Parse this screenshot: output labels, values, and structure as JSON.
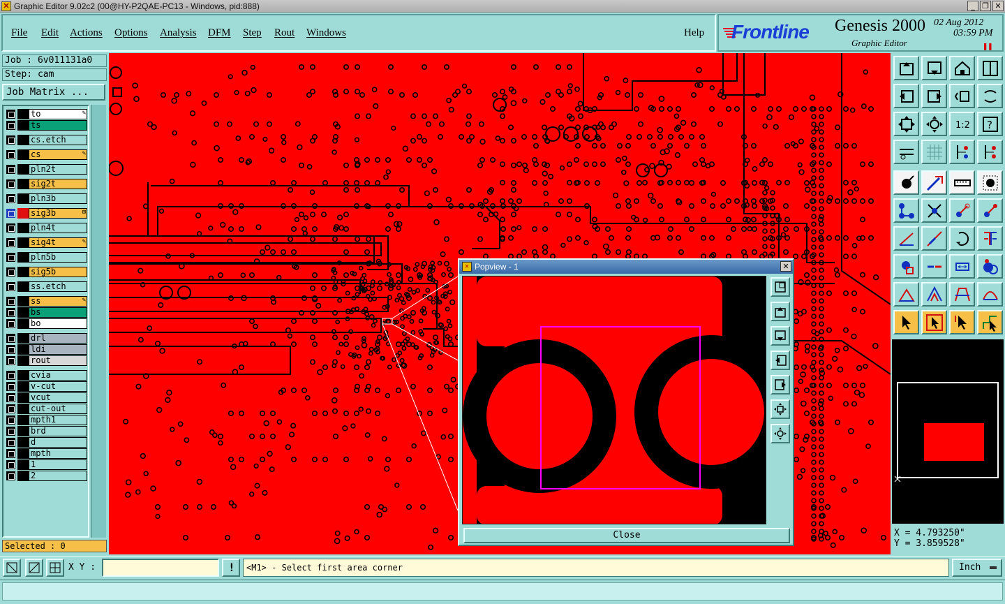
{
  "window": {
    "title": "Graphic Editor 9.02c2 (00@HY-P2QAE-PC13 - Windows, pid:888)",
    "controls": [
      "_",
      "❐",
      "✕"
    ]
  },
  "menu": {
    "items": [
      "File",
      "Edit",
      "Actions",
      "Options",
      "Analysis",
      "DFM",
      "Step",
      "Rout",
      "Windows"
    ],
    "help": "Help"
  },
  "brand": {
    "logo": "Frontline",
    "product": "Genesis 2000",
    "subtitle": "Graphic Editor",
    "date": "02 Aug 2012",
    "time": "03:59 PM"
  },
  "job": {
    "job_text": "Job : 6v011131a0",
    "step_text": "Step: cam",
    "job_matrix_label": "Job Matrix ...",
    "selected_text": "Selected : 0"
  },
  "layers": [
    {
      "name": "to",
      "color": "#ffffff",
      "mark": "✎"
    },
    {
      "name": "ts",
      "color": "#0aa078",
      "mark": ""
    },
    {
      "name": "cs.etch",
      "color": "#9fdcd8",
      "mark": ""
    },
    {
      "name": "cs",
      "color": "#f6c048",
      "mark": "✎"
    },
    {
      "name": "pln2t",
      "color": "#9fdcd8",
      "mark": ""
    },
    {
      "name": "sig2t",
      "color": "#f6c048",
      "mark": ""
    },
    {
      "name": "pln3b",
      "color": "#9fdcd8",
      "mark": ""
    },
    {
      "name": "sig3b",
      "color": "#f6c048",
      "mark": "⊞"
    },
    {
      "name": "pln4t",
      "color": "#9fdcd8",
      "mark": ""
    },
    {
      "name": "sig4t",
      "color": "#f6c048",
      "mark": "✎"
    },
    {
      "name": "pln5b",
      "color": "#9fdcd8",
      "mark": ""
    },
    {
      "name": "sig5b",
      "color": "#f6c048",
      "mark": ""
    },
    {
      "name": "ss.etch",
      "color": "#9fdcd8",
      "mark": ""
    },
    {
      "name": "ss",
      "color": "#f6c048",
      "mark": "✎"
    },
    {
      "name": "bs",
      "color": "#0aa078",
      "mark": ""
    },
    {
      "name": "bo",
      "color": "#ffffff",
      "mark": ""
    },
    {
      "name": "drl",
      "color": "#a8b4c0",
      "mark": ""
    },
    {
      "name": "ldi",
      "color": "#a8b4c0",
      "mark": ""
    },
    {
      "name": "rout",
      "color": "#d8d8d8",
      "mark": ""
    },
    {
      "name": "cvia",
      "color": "#9fdcd8",
      "mark": ""
    },
    {
      "name": "v-cut",
      "color": "#9fdcd8",
      "mark": ""
    },
    {
      "name": "vcut",
      "color": "#9fdcd8",
      "mark": ""
    },
    {
      "name": "cut-out",
      "color": "#9fdcd8",
      "mark": ""
    },
    {
      "name": "mpth1",
      "color": "#9fdcd8",
      "mark": ""
    },
    {
      "name": "brd",
      "color": "#9fdcd8",
      "mark": ""
    },
    {
      "name": "d",
      "color": "#9fdcd8",
      "mark": ""
    },
    {
      "name": "mpth",
      "color": "#9fdcd8",
      "mark": ""
    },
    {
      "name": "1",
      "color": "#9fdcd8",
      "mark": ""
    },
    {
      "name": "2",
      "color": "#9fdcd8",
      "mark": ""
    }
  ],
  "popview": {
    "title": "Popview - 1",
    "close_label": "Close",
    "tools": [
      "zoom-fit-icon",
      "pan-up-icon",
      "pan-down-icon",
      "pan-left-icon",
      "pan-right-icon",
      "zoom-in-icon",
      "zoom-out-icon"
    ]
  },
  "toolbar": {
    "buttons": [
      "pan-up-icon",
      "pan-down-icon",
      "home-icon",
      "split-view-icon",
      "pan-left-icon",
      "pan-right-icon",
      "undo-view-icon",
      "redo-view-icon",
      "zoom-fit-icon",
      "zoom-center-icon",
      "one-to-one-icon",
      "help-icon",
      "snap-icon",
      "grid-icon",
      "layer-display-icon",
      "layer-display-alt-icon",
      "pad-icon",
      "line-icon",
      "measure-icon",
      "select-pad-icon",
      "connect-icon",
      "intersect-icon",
      "move-icon",
      "copy-icon",
      "angle-icon",
      "slant-icon",
      "rotate-icon",
      "mirror-icon",
      "feature-icon",
      "split-line-icon",
      "resize-icon",
      "merge-icon",
      "triangle-icon",
      "tent-icon",
      "arch-icon",
      "arc-icon",
      "pointer-icon",
      "pointer-frame-icon",
      "pointer-select-icon",
      "route-pointer-icon"
    ]
  },
  "coords": {
    "x_text": "X = 4.793250\"",
    "y_text": "Y = 3.859528\""
  },
  "bottom": {
    "xy_label": "X Y :",
    "xy_value": "",
    "excl": "!",
    "prompt": "<M1> - Select first area corner",
    "units": "Inch"
  },
  "colors": {
    "canvas": "#ff0000",
    "panel": "#9fdcd8",
    "selection": "#ff00ff"
  }
}
